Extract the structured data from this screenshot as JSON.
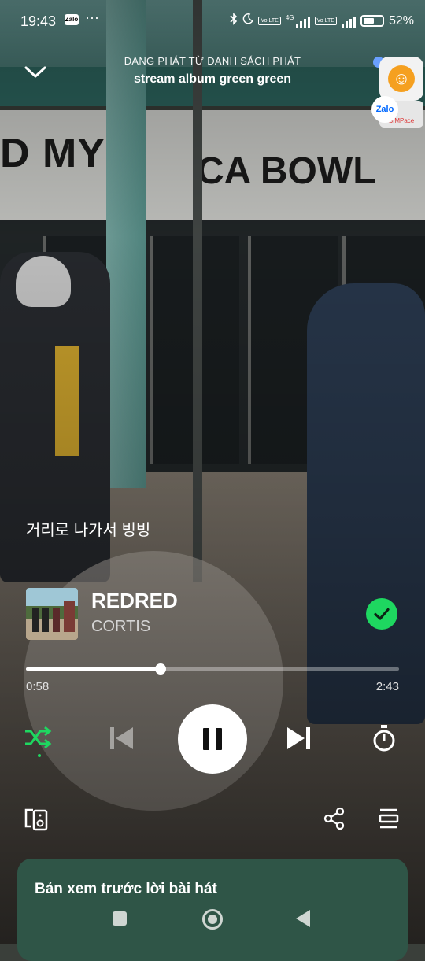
{
  "status_bar": {
    "time": "19:43",
    "zalo_label": "Zalo",
    "more": "···",
    "network": "4G",
    "lte_left": "Vo LTE",
    "lte_right": "Vo LTE",
    "battery": "52%"
  },
  "header": {
    "context_label": "ĐANG PHÁT TỪ DANH SÁCH PHÁT",
    "playlist_name": "stream album green green"
  },
  "floating": {
    "zalo_bubble": "Zalo",
    "thumb_label": "SIMPace"
  },
  "lyric_line": "거리로 나가서 빙빙",
  "track": {
    "title": "REDRED",
    "artist": "CORTIS",
    "liked": true
  },
  "playback": {
    "current_time": "0:58",
    "total_time": "2:43",
    "progress_fraction": 0.36,
    "is_playing": true,
    "shuffle_on": true
  },
  "lyrics_panel": {
    "title": "Bản xem trước lời bài hát"
  },
  "colors": {
    "accent": "#1ed760",
    "lyrics_panel_bg": "#2f5547"
  }
}
